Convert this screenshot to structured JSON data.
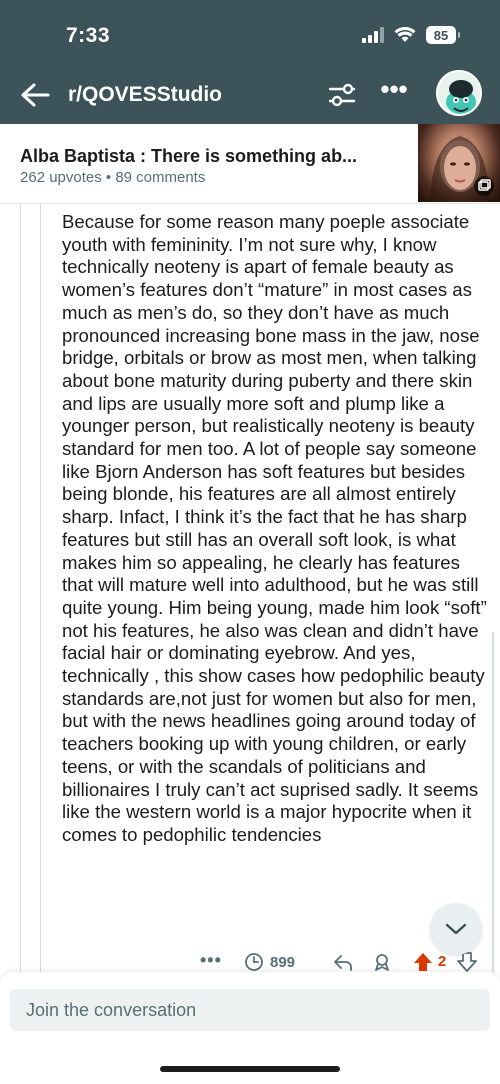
{
  "status": {
    "time": "7:33",
    "battery": "85"
  },
  "nav": {
    "subreddit": "r/QOVESStudio"
  },
  "post": {
    "title": "Alba Baptista : There is something ab...",
    "meta": "262 upvotes • 89 comments"
  },
  "comment": {
    "body": "Because for some reason many poeple associate youth with femininity. I’m not sure why, I know technically neoteny is apart of female beauty as women’s features don’t “mature” in most cases as much as men’s do, so they don’t have as much pronounced increasing bone mass in the jaw, nose bridge, orbitals or brow as most men, when talking about bone maturity during puberty and there skin and lips are usually more soft and plump like a younger person, but realistically neoteny is beauty standard for men too. A lot of people say someone like Bjorn Anderson has soft features but besides being blonde, his features are all almost entirely sharp. Infact, I think it’s the fact that he has sharp features but still has an overall soft look, is what makes him so appealing, he clearly has features that will mature well into adulthood, but he was still quite young. Him being young, made him look “soft” not his features, he also was clean and didn’t have facial hair or dominating eyebrow. And yes, technically , this show cases how pedophilic beauty standards are,not just for women but also for men, but with the news headlines going around today of teachers booking up with young children, or early teens, or with the scandals of politicians and billionaires I truly can’t act suprised sadly. It seems like the western world is a major hypocrite when it comes to pedophilic tendencies",
    "views": "899",
    "score": "2",
    "more": "•••"
  },
  "composer": {
    "placeholder": "Join the conversation"
  },
  "colors": {
    "header_bg": "#3b5359",
    "upvote_active": "#d93a00",
    "muted_text": "#576f76"
  },
  "icons": [
    "back-arrow-icon",
    "filter-icon",
    "more-icon",
    "avatar",
    "views-icon",
    "reply-icon",
    "award-icon",
    "upvote-icon",
    "downvote-icon",
    "chevron-down-icon",
    "wifi-icon",
    "signal-icon"
  ]
}
